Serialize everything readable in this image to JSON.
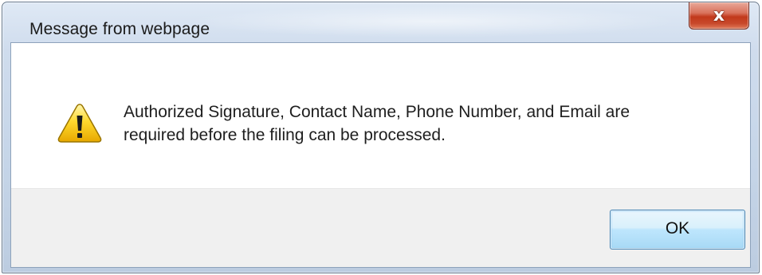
{
  "window": {
    "title": "Message from webpage",
    "close_glyph": "x",
    "close_icon": "close-icon"
  },
  "message": {
    "icon": "warning-icon",
    "line1": "Authorized Signature, Contact Name, Phone Number, and Email are",
    "line2": "required before the filing can be processed."
  },
  "buttons": {
    "ok_label": "OK"
  },
  "colors": {
    "warning_fill": "#f5c400",
    "close_red": "#c2391c",
    "ok_border": "#3c7fb1"
  }
}
